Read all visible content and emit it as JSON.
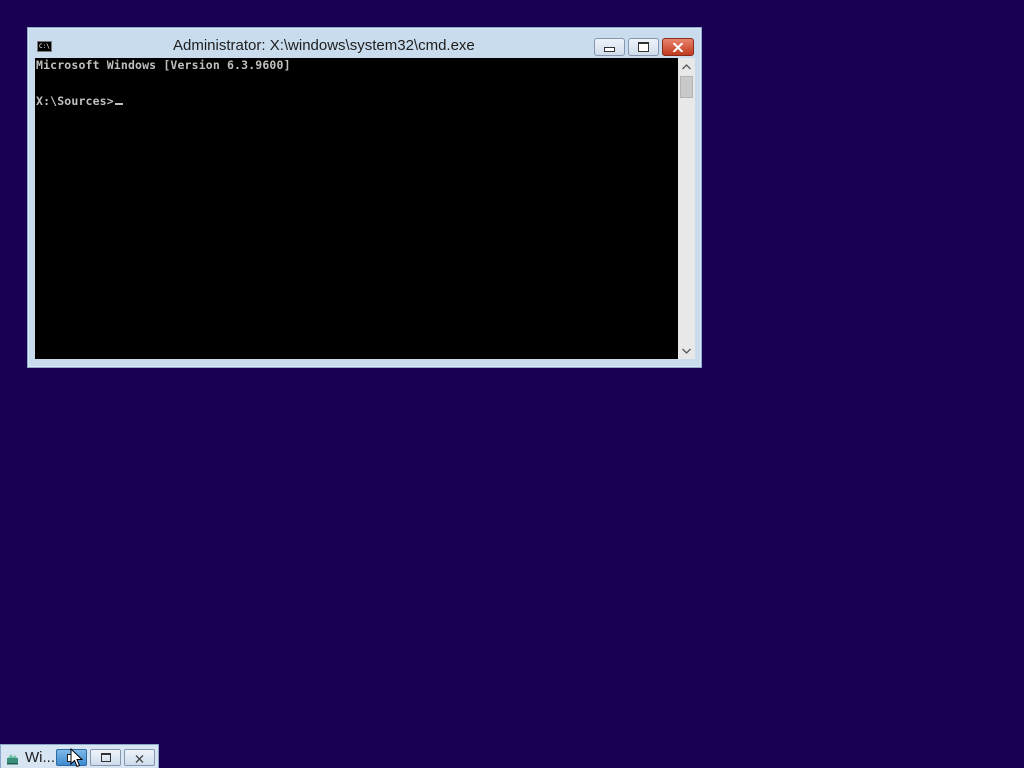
{
  "cmd_window": {
    "title": "Administrator: X:\\windows\\system32\\cmd.exe",
    "app_icon_label": "C:\\",
    "icon": "cmd-icon",
    "buttons": {
      "minimize": "minimize-icon",
      "maximize": "maximize-icon",
      "close": "close-icon"
    },
    "console": {
      "lines": [
        "Microsoft Windows [Version 6.3.9600]",
        "X:\\Sources>"
      ],
      "background": "#000000",
      "text_color": "#c0c0c0"
    },
    "scrollbar": {
      "up": "˄",
      "down": "˅"
    }
  },
  "minimized_window": {
    "title": "Wi...",
    "icon": "setup-icon",
    "buttons": {
      "restore": "restore-icon",
      "maximize": "maximize-icon",
      "close": "close-icon"
    }
  },
  "desktop": {
    "background": "#1a0053"
  }
}
